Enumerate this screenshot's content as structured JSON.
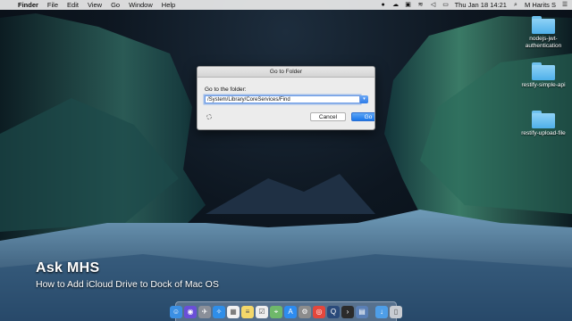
{
  "menubar": {
    "app_name": "Finder",
    "items": [
      "File",
      "Edit",
      "View",
      "Go",
      "Window",
      "Help"
    ],
    "clock": "Thu Jan 18  14:21",
    "user": "M Harits S"
  },
  "desktop_icons": [
    {
      "label": "nodejs-jwt-authentication",
      "icon": "folder-icon"
    },
    {
      "label": "restify-simple-api",
      "icon": "folder-icon"
    },
    {
      "label": "restify-upload-file",
      "icon": "folder-icon"
    }
  ],
  "dialog": {
    "title": "Go to Folder",
    "prompt": "Go to the folder:",
    "path_value": "/System/Library/CoreServices/Find",
    "cancel_label": "Cancel",
    "go_label": "Go"
  },
  "overlay": {
    "brand": "Ask MHS",
    "subtitle": "How to Add iCloud Drive to Dock of Mac OS"
  },
  "dock": {
    "apps": [
      {
        "name": "finder-icon",
        "color": "#3b8fe3"
      },
      {
        "name": "siri-icon",
        "color": "#6a4fd8"
      },
      {
        "name": "launchpad-icon",
        "color": "#8a8f99"
      },
      {
        "name": "safari-icon",
        "color": "#2f8ee8"
      },
      {
        "name": "calendar-icon",
        "color": "#f2f2f2"
      },
      {
        "name": "notes-icon",
        "color": "#f5d86a"
      },
      {
        "name": "reminders-icon",
        "color": "#eeeeee"
      },
      {
        "name": "maps-icon",
        "color": "#6fb86a"
      },
      {
        "name": "app-store-icon",
        "color": "#2d8cf0"
      },
      {
        "name": "system-preferences-icon",
        "color": "#8c8c8c"
      },
      {
        "name": "chrome-icon",
        "color": "#e4473c"
      },
      {
        "name": "quicktime-icon",
        "color": "#2a4a7a"
      },
      {
        "name": "terminal-icon",
        "color": "#2b2b2b"
      },
      {
        "name": "photos-icon",
        "color": "#5a7fb5"
      },
      {
        "name": "downloads-icon",
        "color": "#4e9ee8"
      },
      {
        "name": "trash-icon",
        "color": "#c8ccd2"
      }
    ]
  }
}
